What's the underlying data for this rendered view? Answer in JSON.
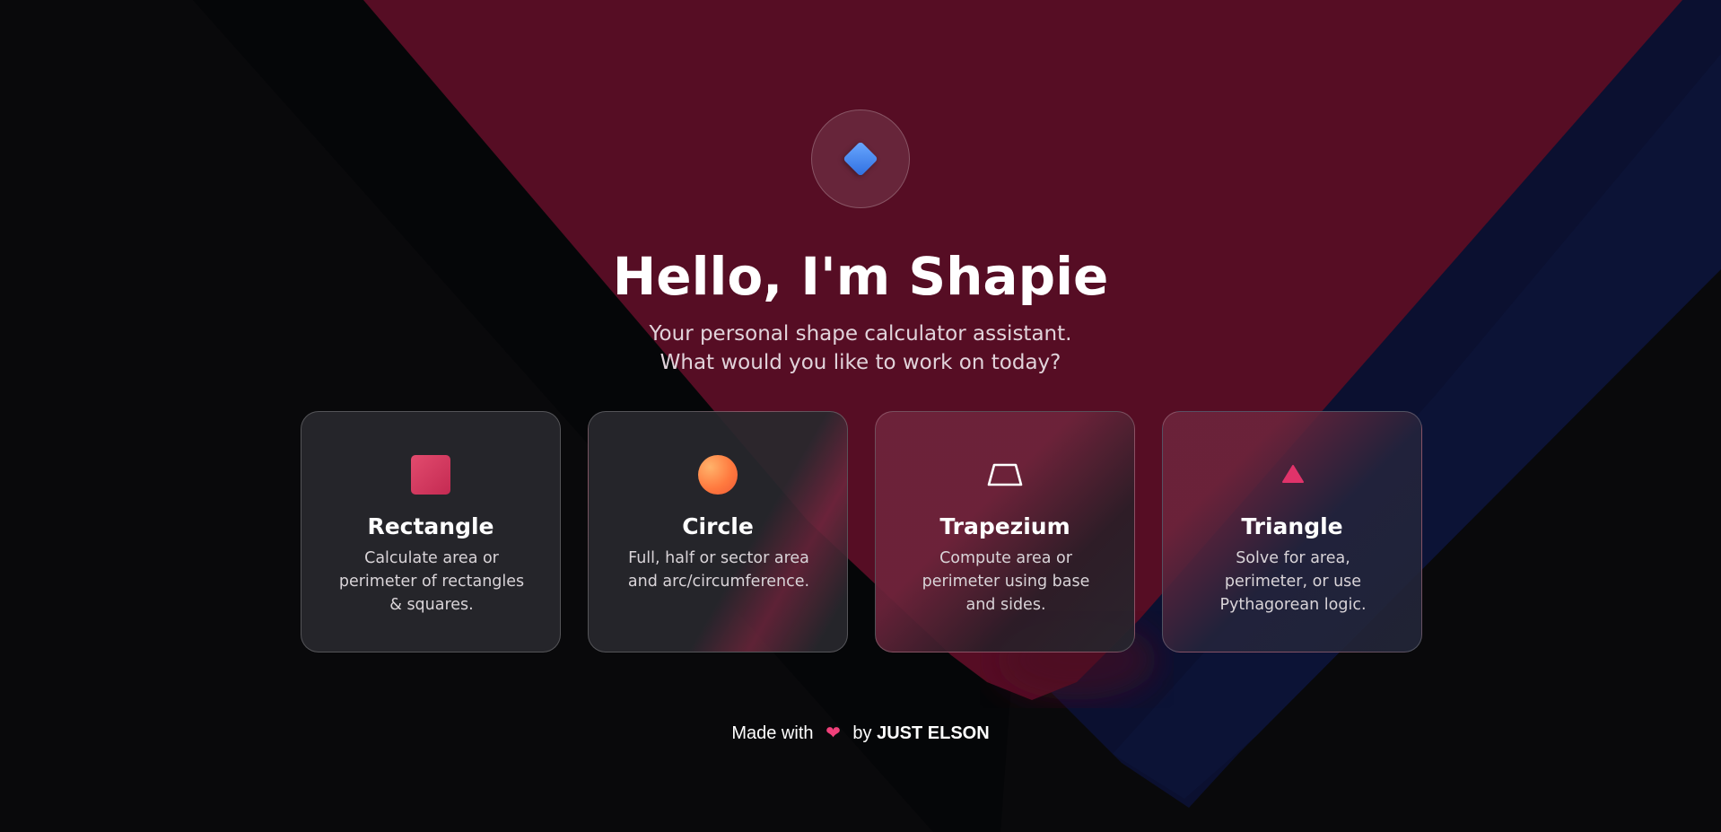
{
  "hero": {
    "logo_icon": "diamond-icon",
    "title": "Hello, I'm Shapie",
    "subtitle_line1": "Your personal shape calculator assistant.",
    "subtitle_line2": "What would you like to work on today?"
  },
  "cards": [
    {
      "icon": "square-icon",
      "title": "Rectangle",
      "desc_lines": [
        "Calculate area or",
        "perimeter of rectangles",
        "& squares."
      ]
    },
    {
      "icon": "circle-icon",
      "title": "Circle",
      "desc_lines": [
        "Full, half or sector area",
        "and arc/circumference."
      ]
    },
    {
      "icon": "trapezium-icon",
      "title": "Trapezium",
      "desc_lines": [
        "Compute area or",
        "perimeter using base",
        "and sides."
      ]
    },
    {
      "icon": "triangle-icon",
      "title": "Triangle",
      "desc_lines": [
        "Solve for area,",
        "perimeter, or use",
        "Pythagorean logic."
      ]
    }
  ],
  "footer": {
    "prefix": "Made with",
    "heart_icon": "heart-icon",
    "heart_glyph": "❤",
    "middle": "by",
    "author": "JUST ELSON"
  },
  "colors": {
    "background": "#0a0a0c",
    "crimson_panel": "#560d24",
    "navy_band": "#0c1235",
    "accent_blue": "#3b82f6",
    "accent_pink": "#e0336a",
    "accent_orange": "#ff7a3f"
  }
}
